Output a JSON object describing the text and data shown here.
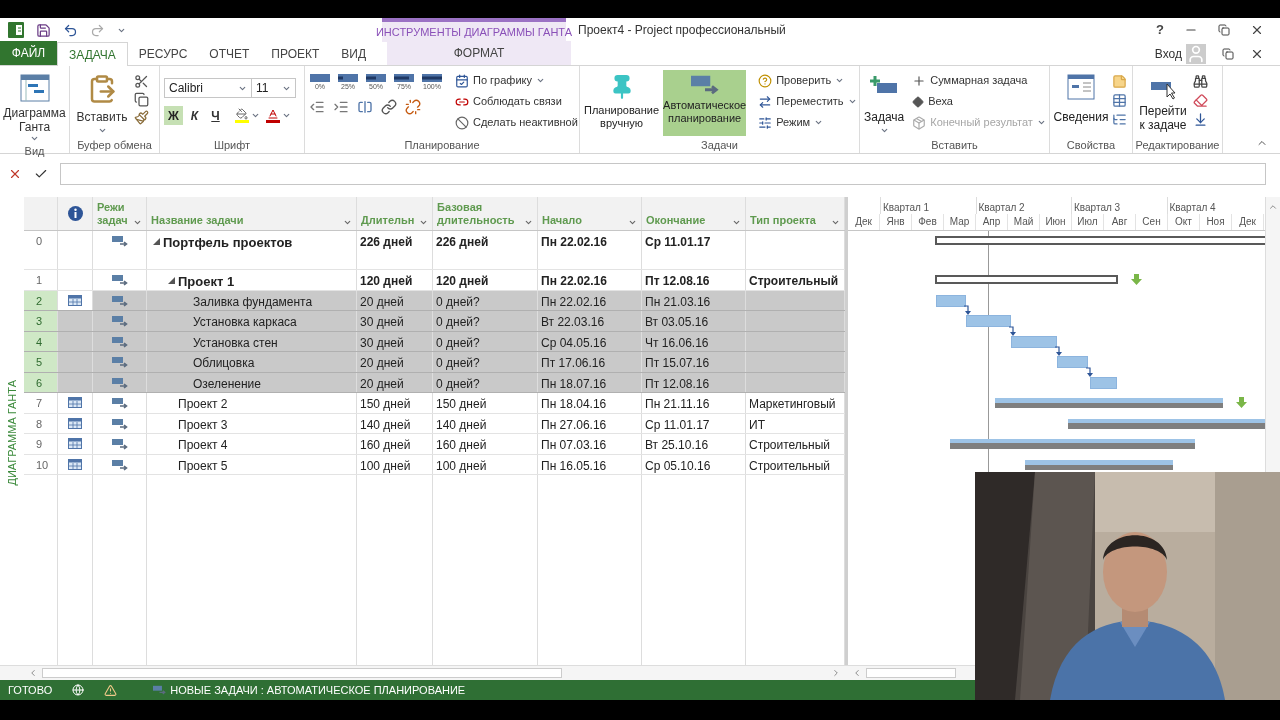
{
  "context_tab_group": "ИНСТРУМЕНТЫ ДИАГРАММЫ ГАНТА",
  "window_title": "Проект4 - Project профессиональный",
  "help": "?",
  "sign_in": "Вход",
  "tabs": [
    {
      "label": "ФАЙЛ",
      "kind": "file",
      "selected": false
    },
    {
      "label": "ЗАДАЧА",
      "kind": "normal",
      "selected": true
    },
    {
      "label": "РЕСУРС",
      "kind": "normal",
      "selected": false
    },
    {
      "label": "ОТЧЕТ",
      "kind": "normal",
      "selected": false
    },
    {
      "label": "ПРОЕКТ",
      "kind": "normal",
      "selected": false
    },
    {
      "label": "ВИД",
      "kind": "normal",
      "selected": false
    },
    {
      "label": "ФОРМАТ",
      "kind": "context",
      "selected": false
    }
  ],
  "ribbon": [
    {
      "kind": "view",
      "label": "Вид",
      "button": "Диаграмма Ганта"
    },
    {
      "kind": "clipboard",
      "label": "Буфер обмена",
      "paste": "Вставить"
    },
    {
      "kind": "font",
      "label": "Шрифт",
      "font": "Calibri",
      "size": "11",
      "styles": [
        {
          "label": "Ж",
          "selected": true
        },
        {
          "label": "К",
          "selected": false
        },
        {
          "label": "Ч",
          "selected": false
        }
      ]
    },
    {
      "kind": "schedule",
      "label": "Планирование",
      "percents": [
        "0%",
        "25%",
        "50%",
        "75%",
        "100%"
      ],
      "commands": [
        "По графику",
        "Соблюдать связи",
        "Сделать неактивной"
      ]
    },
    {
      "kind": "tasks",
      "label": "Задачи",
      "modes": [
        {
          "label": "Планирование вручную",
          "selected": false
        },
        {
          "label": "Автоматическое планирование",
          "selected": true
        }
      ],
      "commands": [
        "Проверить",
        "Переместить",
        "Режим"
      ]
    },
    {
      "kind": "insert",
      "label": "Вставить",
      "task": "Задача",
      "commands": [
        {
          "label": "Суммарная задача",
          "disabled": false
        },
        {
          "label": "Веха",
          "disabled": false
        },
        {
          "label": "Конечный результат",
          "disabled": true
        }
      ]
    },
    {
      "kind": "properties",
      "label": "Свойства",
      "info": "Сведения"
    },
    {
      "kind": "editing",
      "label": "Редактирование",
      "goto": "Перейти к задаче"
    }
  ],
  "view_bar": "ДИАГРАММА ГАНТА",
  "table": {
    "columns": [
      "Режи задач",
      "Название задачи",
      "Длительн",
      "Базовая длительность",
      "Начало",
      "Окончание",
      "Тип проекта"
    ],
    "rows": [
      {
        "id": "0",
        "name": "Портфель проектов",
        "duration": "226 дней",
        "baseline": "226 дней",
        "start": "Пн 22.02.16",
        "finish": "Ср 11.01.17",
        "summary": true,
        "expanded": true,
        "selected": false,
        "indicator": false,
        "kind": "summary",
        "deadline": false,
        "children": [
          {
            "id": "1",
            "name": "Проект 1",
            "duration": "120 дней",
            "baseline": "120 дней",
            "start": "Пн 22.02.16",
            "finish": "Пт 12.08.16",
            "type": "Строительный",
            "summary": true,
            "expanded": true,
            "selected": false,
            "indicator": false,
            "kind": "summary",
            "deadline": true,
            "children": [
              {
                "id": "2",
                "name": "Заливка фундамента",
                "duration": "20 дней",
                "baseline": "0 дней?",
                "start": "Пн 22.02.16",
                "finish": "Пн 21.03.16",
                "summary": false,
                "selected": true,
                "indicator": true,
                "kind": "task",
                "deadline": false
              },
              {
                "id": "3",
                "name": "Установка каркаса",
                "duration": "30 дней",
                "baseline": "0 дней?",
                "start": "Вт 22.03.16",
                "finish": "Вт 03.05.16",
                "summary": false,
                "selected": true,
                "indicator": false,
                "kind": "task",
                "deadline": false
              },
              {
                "id": "4",
                "name": "Установка стен",
                "duration": "30 дней",
                "baseline": "0 дней?",
                "start": "Ср 04.05.16",
                "finish": "Чт 16.06.16",
                "summary": false,
                "selected": true,
                "indicator": false,
                "kind": "task",
                "deadline": false
              },
              {
                "id": "5",
                "name": "Облицовка",
                "duration": "20 дней",
                "baseline": "0 дней?",
                "start": "Пт 17.06.16",
                "finish": "Пт 15.07.16",
                "summary": false,
                "selected": true,
                "indicator": false,
                "kind": "task",
                "deadline": false
              },
              {
                "id": "6",
                "name": "Озеленение",
                "duration": "20 дней",
                "baseline": "0 дней?",
                "start": "Пн 18.07.16",
                "finish": "Пт 12.08.16",
                "summary": false,
                "selected": true,
                "indicator": false,
                "kind": "task",
                "deadline": false
              }
            ]
          },
          {
            "id": "7",
            "name": "Проект 2",
            "duration": "150 дней",
            "baseline": "150 дней",
            "start": "Пн 18.04.16",
            "finish": "Пн 21.11.16",
            "type": "Маркетинговый",
            "summary": false,
            "selected": false,
            "indicator": true,
            "kind": "project",
            "deadline": true
          },
          {
            "id": "8",
            "name": "Проект 3",
            "duration": "140 дней",
            "baseline": "140 дней",
            "start": "Пн 27.06.16",
            "finish": "Ср 11.01.17",
            "type": "ИТ",
            "summary": false,
            "selected": false,
            "indicator": true,
            "kind": "project",
            "deadline": false
          },
          {
            "id": "9",
            "name": "Проект 4",
            "duration": "160 дней",
            "baseline": "160 дней",
            "start": "Пн 07.03.16",
            "finish": "Вт 25.10.16",
            "type": "Строительный",
            "summary": false,
            "selected": false,
            "indicator": true,
            "kind": "project",
            "deadline": false
          },
          {
            "id": "10",
            "name": "Проект 5",
            "duration": "100 дней",
            "baseline": "100 дней",
            "start": "Пн 16.05.16",
            "finish": "Ср 05.10.16",
            "type": "Строительный",
            "summary": false,
            "selected": false,
            "indicator": true,
            "kind": "project",
            "deadline": false
          }
        ]
      }
    ]
  },
  "timescale": {
    "quarters": [
      "Квартал 1",
      "Квартал 2",
      "Квартал 3",
      "Квартал 4"
    ],
    "months": [
      "Дек",
      "Янв",
      "Фев",
      "Мар",
      "Апр",
      "Май",
      "Июн",
      "Июл",
      "Авг",
      "Сен",
      "Окт",
      "Ноя",
      "Дек"
    ]
  },
  "status_bar": {
    "ready": "ГОТОВО",
    "mode": "НОВЫЕ ЗАДАЧИ : АВТОМАТИЧЕСКОЕ ПЛАНИРОВАНИЕ"
  }
}
